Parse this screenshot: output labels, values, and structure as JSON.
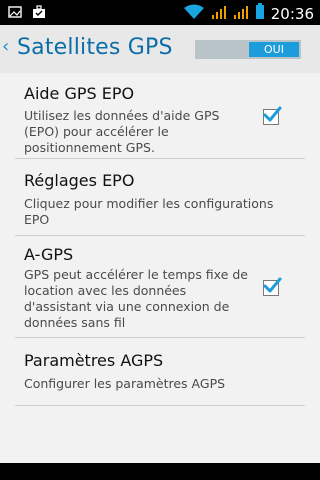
{
  "status_bar": {
    "time": "20:36",
    "left_icons": [
      "image-icon",
      "briefcase-icon"
    ],
    "right_icons": [
      "wifi-icon",
      "signal-icon-1",
      "signal-icon-2",
      "battery-icon"
    ]
  },
  "action_bar": {
    "title": "Satellites GPS",
    "toggle_label": "OUI",
    "accent_color": "#1d9cdc"
  },
  "preferences": [
    {
      "title": "Aide GPS EPO",
      "summary": "Utilisez les données d'aide GPS (EPO) pour accélérer le positionnement GPS.",
      "checkbox": true
    },
    {
      "title": "Réglages EPO",
      "summary": "Cliquez pour modifier les configurations EPO",
      "checkbox": false
    },
    {
      "title": "A-GPS",
      "summary": "GPS peut accélérer le temps fixe de location avec les données d'assistant via une connexion de données sans fil",
      "checkbox": true
    },
    {
      "title": "Paramètres AGPS",
      "summary": "Configurer les paramètres AGPS",
      "checkbox": false
    }
  ]
}
